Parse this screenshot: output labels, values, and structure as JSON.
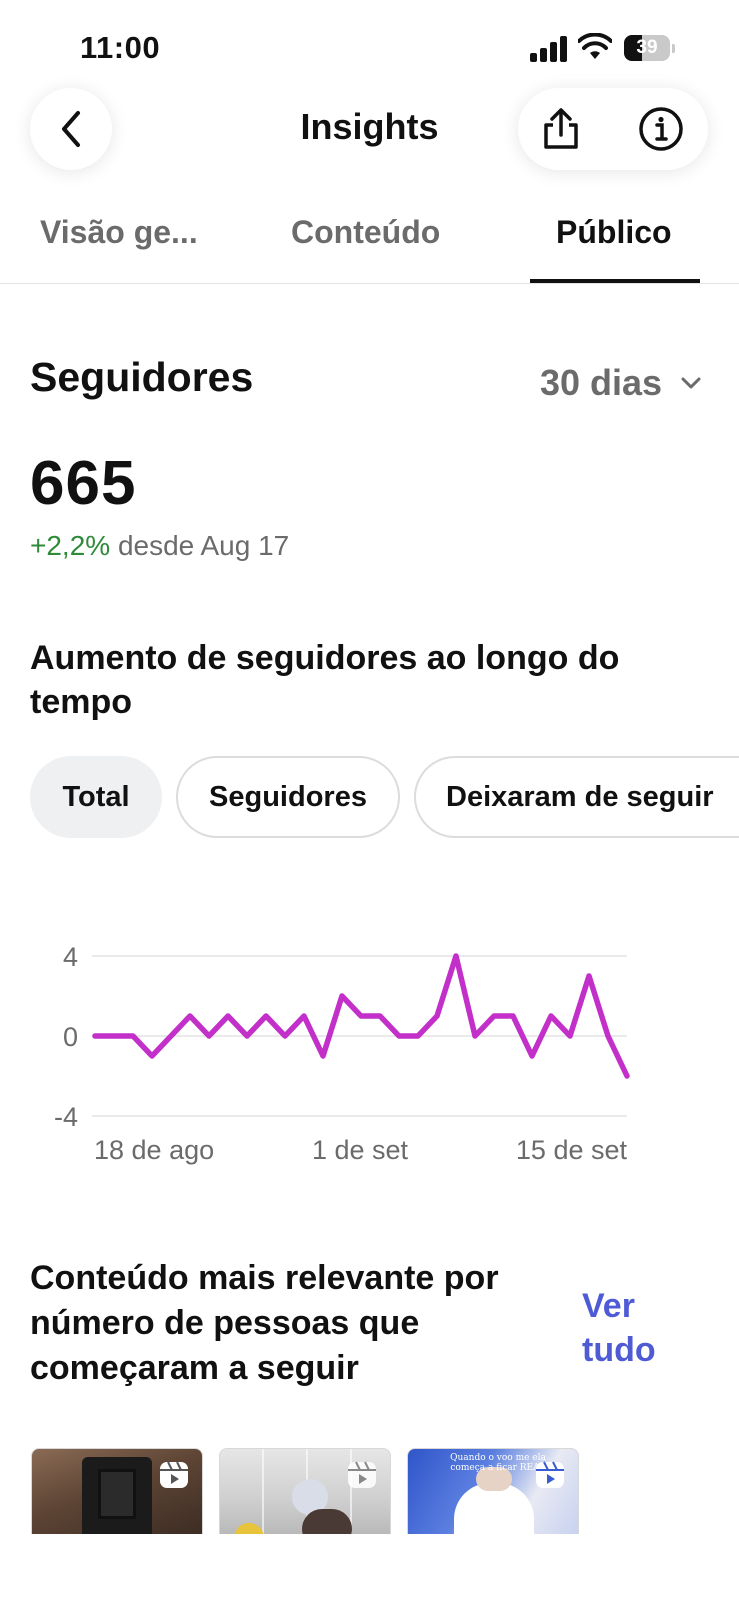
{
  "status_bar": {
    "time": "11:00",
    "battery": "39",
    "battery_level": 0.39
  },
  "header": {
    "title": "Insights"
  },
  "tabs": [
    {
      "label": "Visão ge...",
      "active": false
    },
    {
      "label": "Conteúdo",
      "active": false
    },
    {
      "label": "Público",
      "active": true
    }
  ],
  "followers": {
    "title": "Seguidores",
    "period": "30 dias",
    "count": "665",
    "change_pct": "+2,2%",
    "change_since": "desde Aug 17"
  },
  "growth": {
    "title": "Aumento de seguidores ao longo do tempo",
    "chips": [
      {
        "label": "Total",
        "active": true
      },
      {
        "label": "Seguidores",
        "active": false
      },
      {
        "label": "Deixaram de seguir",
        "active": false
      }
    ]
  },
  "chart_data": {
    "type": "line",
    "title": "",
    "xlabel": "",
    "ylabel": "",
    "ylim": [
      -4,
      4
    ],
    "yticks": [
      "4",
      "0",
      "-4"
    ],
    "xticks": [
      "18 de ago",
      "1 de set",
      "15 de set"
    ],
    "grid": true,
    "color": "#c22fc9",
    "series": [
      {
        "values": [
          0,
          0,
          0,
          -1,
          0,
          1,
          0,
          1,
          0,
          1,
          0,
          1,
          -1,
          2,
          1,
          1,
          0,
          0,
          1,
          4,
          0,
          1,
          1,
          -1,
          1,
          0,
          3,
          0,
          -2
        ]
      }
    ]
  },
  "relevant": {
    "title": "Conteúdo mais relevante por número de pessoas que começaram a seguir",
    "see_all": "Ver tudo"
  },
  "thumbnails": [
    {
      "name": "thumbnail-1",
      "icon": "reels-icon"
    },
    {
      "name": "thumbnail-2",
      "icon": "reels-icon"
    },
    {
      "name": "thumbnail-3",
      "icon": "reels-icon",
      "overlay_text": "Quando o voo me ela começa a ficar REAL"
    }
  ],
  "colors": {
    "accent_link": "#4f5bd5",
    "positive": "#2f8a3a",
    "chart_line": "#c22fc9"
  }
}
